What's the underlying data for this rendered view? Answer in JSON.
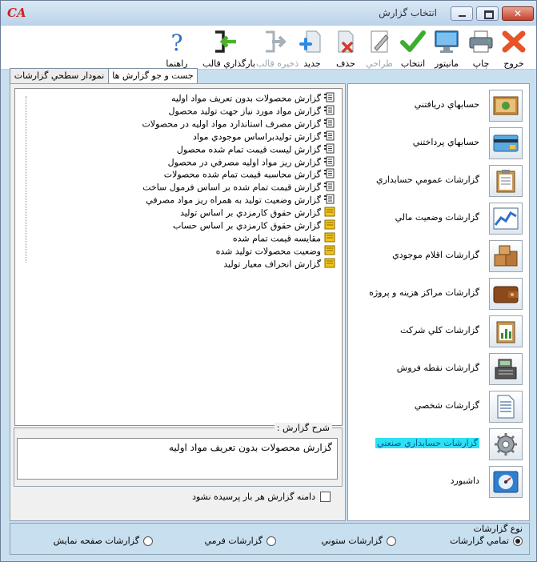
{
  "window": {
    "title": "انتخاب گزارش",
    "logo": "CA"
  },
  "toolbar": {
    "items": [
      {
        "label": "خروج",
        "icon": "close-x-icon",
        "enabled": true
      },
      {
        "label": "چاپ",
        "icon": "printer-icon",
        "enabled": true
      },
      {
        "label": "مانيتور",
        "icon": "monitor-icon",
        "enabled": true
      },
      {
        "label": "انتخاب",
        "icon": "checkmark-icon",
        "enabled": true
      },
      {
        "label": "طراحي",
        "icon": "design-pencil-icon",
        "enabled": false
      },
      {
        "label": "حذف",
        "icon": "delete-document-icon",
        "enabled": true
      },
      {
        "label": "جديد",
        "icon": "new-document-icon",
        "enabled": true
      },
      {
        "label": "ذخيره قالب",
        "icon": "save-template-icon",
        "enabled": false
      },
      {
        "label": "بارگذاري قالب",
        "icon": "load-template-icon",
        "enabled": true
      },
      {
        "label": "راهنما",
        "icon": "help-icon",
        "enabled": true
      }
    ]
  },
  "tabs": [
    {
      "label": "نمودار سطحي گزارشات",
      "active": true
    },
    {
      "label": "جست و جو گزارش ها",
      "active": false
    }
  ],
  "tree": {
    "items": [
      {
        "label": "گزارش محصولات بدون تعريف مواد اوليه",
        "icon": "report-doc-icon"
      },
      {
        "label": "گزارش مواد مورد نياز جهت توليد محصول",
        "icon": "report-doc-icon"
      },
      {
        "label": "گزارش مصرف استاندارد مواد اوليه در محصولات",
        "icon": "report-doc-icon"
      },
      {
        "label": "گزارش توليدبراساس موجودي مواد",
        "icon": "report-doc-icon"
      },
      {
        "label": "گزارش ليست قيمت تمام شده محصول",
        "icon": "report-doc-icon"
      },
      {
        "label": "گزارش ريز مواد اوليه مصرفي در محصول",
        "icon": "report-doc-icon"
      },
      {
        "label": "گزارش محاسبه قيمت تمام شده محصولات",
        "icon": "report-doc-icon"
      },
      {
        "label": "گزارش قيمت تمام شده بر اساس فرمول ساخت",
        "icon": "report-doc-icon"
      },
      {
        "label": "گزارش وضعيت توليد به همراه ريز مواد مصرفي",
        "icon": "report-doc-icon"
      },
      {
        "label": "گزارش حقوق كارمزدي بر اساس توليد",
        "icon": "folder-report-icon"
      },
      {
        "label": "گزارش حقوق كارمزدي بر اساس حساب",
        "icon": "folder-report-icon"
      },
      {
        "label": "مقايسه قيمت تمام شده",
        "icon": "folder-report-icon"
      },
      {
        "label": "وضعيت محصولات توليد شده",
        "icon": "folder-report-icon"
      },
      {
        "label": "گزارش انحراف معيار توليد",
        "icon": "folder-report-icon"
      }
    ]
  },
  "description": {
    "legend": "شرح گزارش :",
    "text": "گزارش محصولات بدون تعريف مواد اوليه"
  },
  "checkbox": {
    "label": "دامنه گزارش هر بار پرسيده نشود",
    "checked": false
  },
  "categories": {
    "items": [
      {
        "label": "حسابهاي دريافتني",
        "icon": "receivables-icon"
      },
      {
        "label": "حسابهاي پرداختني",
        "icon": "payables-card-icon"
      },
      {
        "label": "گزارشات عمومي حسابداري",
        "icon": "clipboard-icon"
      },
      {
        "label": "گزارشات وضعيت مالي",
        "icon": "line-chart-icon"
      },
      {
        "label": "گزارشات اقلام موجودي",
        "icon": "boxes-icon"
      },
      {
        "label": "گزارشات مراكز هزينه و پروژه",
        "icon": "wallet-icon"
      },
      {
        "label": "گزارشات كلي شركت",
        "icon": "bar-chart-clipboard-icon"
      },
      {
        "label": "گزارشات نقطه فروش",
        "icon": "cash-register-icon"
      },
      {
        "label": "گزارشات شخصي",
        "icon": "document-lines-icon"
      },
      {
        "label": "گزارشات حسابداري صنعتي",
        "icon": "gear-icon",
        "highlighted": true
      },
      {
        "label": "داشبورد",
        "icon": "dashboard-icon"
      }
    ]
  },
  "report_type": {
    "title": "نوع گزارشات",
    "options": [
      {
        "label": "تمامي گزارشات",
        "selected": true
      },
      {
        "label": "گزارشات ستوني",
        "selected": false
      },
      {
        "label": "گزارشات فرمي",
        "selected": false
      },
      {
        "label": "گزارشات صفحه نمايش",
        "selected": false
      }
    ]
  }
}
